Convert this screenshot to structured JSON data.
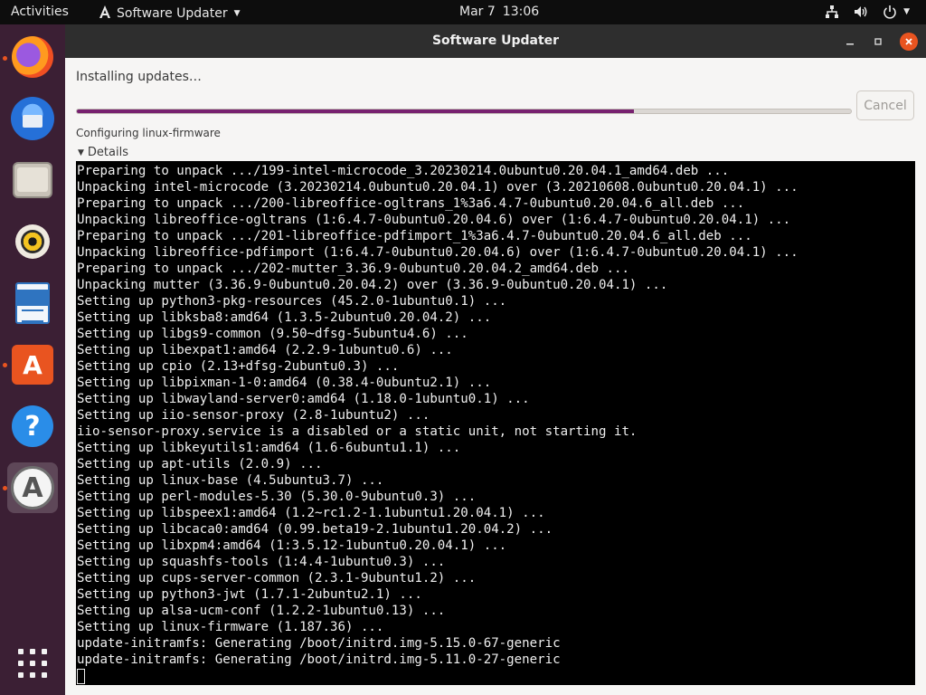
{
  "topbar": {
    "activities": "Activities",
    "app_name": "Software Updater",
    "date": "Mar 7",
    "time": "13:06"
  },
  "dock": {
    "items": [
      {
        "name": "firefox",
        "active": false,
        "running": true
      },
      {
        "name": "thunderbird",
        "active": false,
        "running": false
      },
      {
        "name": "files",
        "active": false,
        "running": false
      },
      {
        "name": "rhythmbox",
        "active": false,
        "running": false
      },
      {
        "name": "libreoffice-writer",
        "active": false,
        "running": false
      },
      {
        "name": "ubuntu-software",
        "active": false,
        "running": true
      },
      {
        "name": "help",
        "active": false,
        "running": false
      },
      {
        "name": "software-updater",
        "active": true,
        "running": true
      }
    ],
    "show_apps_icon": "grid-icon"
  },
  "window": {
    "title": "Software Updater",
    "status_title": "Installing updates…",
    "cancel_label": "Cancel",
    "progress_fraction": 0.72,
    "current_action": "Configuring linux-firmware",
    "details_label": "Details",
    "accent_color": "#77216f"
  },
  "terminal": {
    "lines": [
      "Preparing to unpack .../199-intel-microcode_3.20230214.0ubuntu0.20.04.1_amd64.deb ...",
      "Unpacking intel-microcode (3.20230214.0ubuntu0.20.04.1) over (3.20210608.0ubuntu0.20.04.1) ...",
      "Preparing to unpack .../200-libreoffice-ogltrans_1%3a6.4.7-0ubuntu0.20.04.6_all.deb ...",
      "Unpacking libreoffice-ogltrans (1:6.4.7-0ubuntu0.20.04.6) over (1:6.4.7-0ubuntu0.20.04.1) ...",
      "Preparing to unpack .../201-libreoffice-pdfimport_1%3a6.4.7-0ubuntu0.20.04.6_all.deb ...",
      "Unpacking libreoffice-pdfimport (1:6.4.7-0ubuntu0.20.04.6) over (1:6.4.7-0ubuntu0.20.04.1) ...",
      "Preparing to unpack .../202-mutter_3.36.9-0ubuntu0.20.04.2_amd64.deb ...",
      "Unpacking mutter (3.36.9-0ubuntu0.20.04.2) over (3.36.9-0ubuntu0.20.04.1) ...",
      "Setting up python3-pkg-resources (45.2.0-1ubuntu0.1) ...",
      "Setting up libksba8:amd64 (1.3.5-2ubuntu0.20.04.2) ...",
      "Setting up libgs9-common (9.50~dfsg-5ubuntu4.6) ...",
      "Setting up libexpat1:amd64 (2.2.9-1ubuntu0.6) ...",
      "Setting up cpio (2.13+dfsg-2ubuntu0.3) ...",
      "Setting up libpixman-1-0:amd64 (0.38.4-0ubuntu2.1) ...",
      "Setting up libwayland-server0:amd64 (1.18.0-1ubuntu0.1) ...",
      "Setting up iio-sensor-proxy (2.8-1ubuntu2) ...",
      "iio-sensor-proxy.service is a disabled or a static unit, not starting it.",
      "Setting up libkeyutils1:amd64 (1.6-6ubuntu1.1) ...",
      "Setting up apt-utils (2.0.9) ...",
      "Setting up linux-base (4.5ubuntu3.7) ...",
      "Setting up perl-modules-5.30 (5.30.0-9ubuntu0.3) ...",
      "Setting up libspeex1:amd64 (1.2~rc1.2-1.1ubuntu1.20.04.1) ...",
      "Setting up libcaca0:amd64 (0.99.beta19-2.1ubuntu1.20.04.2) ...",
      "Setting up libxpm4:amd64 (1:3.5.12-1ubuntu0.20.04.1) ...",
      "Setting up squashfs-tools (1:4.4-1ubuntu0.3) ...",
      "Setting up cups-server-common (2.3.1-9ubuntu1.2) ...",
      "Setting up python3-jwt (1.7.1-2ubuntu2.1) ...",
      "Setting up alsa-ucm-conf (1.2.2-1ubuntu0.13) ...",
      "Setting up linux-firmware (1.187.36) ...",
      "update-initramfs: Generating /boot/initrd.img-5.15.0-67-generic",
      "update-initramfs: Generating /boot/initrd.img-5.11.0-27-generic"
    ]
  }
}
